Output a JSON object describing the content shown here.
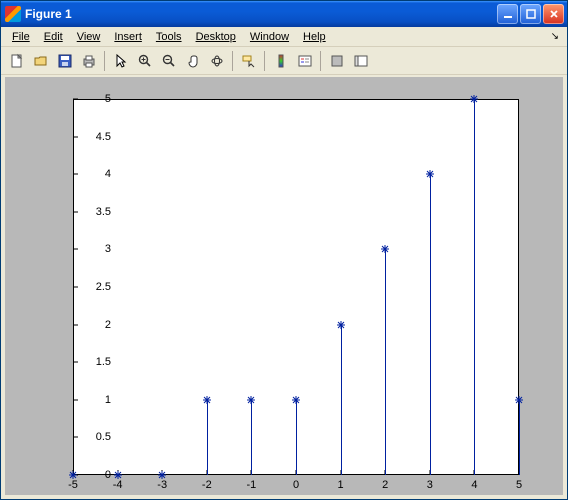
{
  "window": {
    "title": "Figure 1"
  },
  "menubar": {
    "file": "File",
    "edit": "Edit",
    "view": "View",
    "insert": "Insert",
    "tools": "Tools",
    "desktop": "Desktop",
    "window": "Window",
    "help": "Help"
  },
  "chart_data": {
    "type": "stem",
    "x": [
      -5,
      -4,
      -3,
      -2,
      -1,
      0,
      1,
      2,
      3,
      4,
      5
    ],
    "y": [
      0,
      0,
      0,
      1,
      1,
      1,
      2,
      3,
      4,
      5,
      1
    ],
    "xlabel": "",
    "ylabel": "",
    "title": "",
    "xlim": [
      -5,
      5
    ],
    "ylim": [
      0,
      5
    ],
    "xticks": [
      -5,
      -4,
      -3,
      -2,
      -1,
      0,
      1,
      2,
      3,
      4,
      5
    ],
    "yticks": [
      0,
      0.5,
      1,
      1.5,
      2,
      2.5,
      3,
      3.5,
      4,
      4.5,
      5
    ],
    "grid": false,
    "marker": "*",
    "line_color": "#0020a0"
  }
}
